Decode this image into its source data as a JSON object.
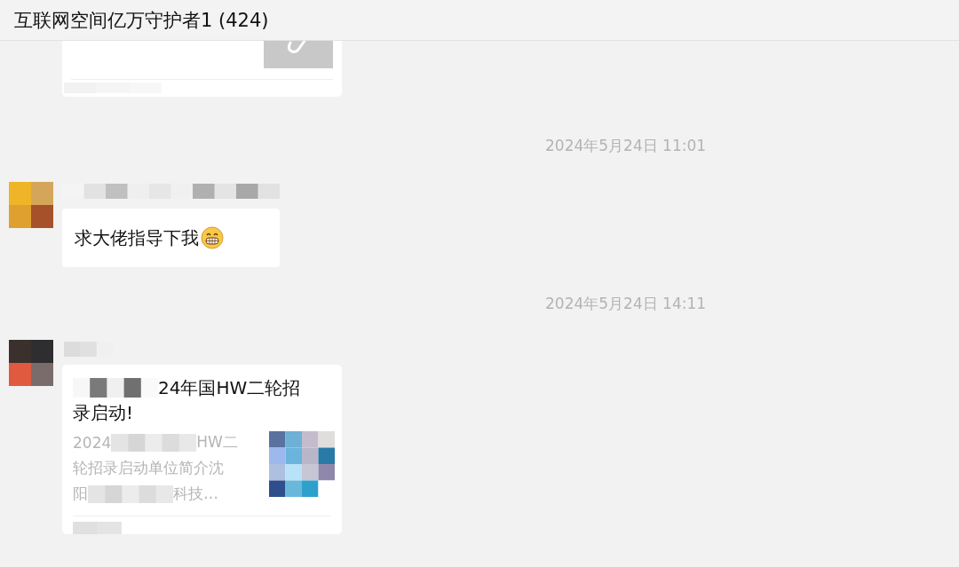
{
  "header": {
    "title": "互联网空间亿万守护者1 (424)"
  },
  "messages": [
    {
      "kind": "card-partial"
    },
    {
      "kind": "timestamp",
      "text": "2024年5月24日 11:01"
    },
    {
      "kind": "text",
      "text": "求大佬指导下我"
    },
    {
      "kind": "timestamp",
      "text": "2024年5月24日 14:11"
    },
    {
      "kind": "link-card",
      "title_lines": [
        [
          {
            "kind": "redacted"
          },
          {
            "kind": "text",
            "text": "24年国HW二轮招"
          }
        ],
        [
          {
            "kind": "text",
            "text": "录启动!"
          }
        ]
      ],
      "description_lines": [
        [
          {
            "kind": "text",
            "text": "2024"
          },
          {
            "kind": "redacted"
          },
          {
            "kind": "text",
            "text": "HW二"
          }
        ],
        [
          {
            "kind": "text",
            "text": "轮招录启动单位简介沈"
          }
        ],
        [
          {
            "kind": "text",
            "text": "阳"
          },
          {
            "kind": "redacted"
          },
          {
            "kind": "text",
            "text": "科技…"
          }
        ]
      ]
    }
  ]
}
